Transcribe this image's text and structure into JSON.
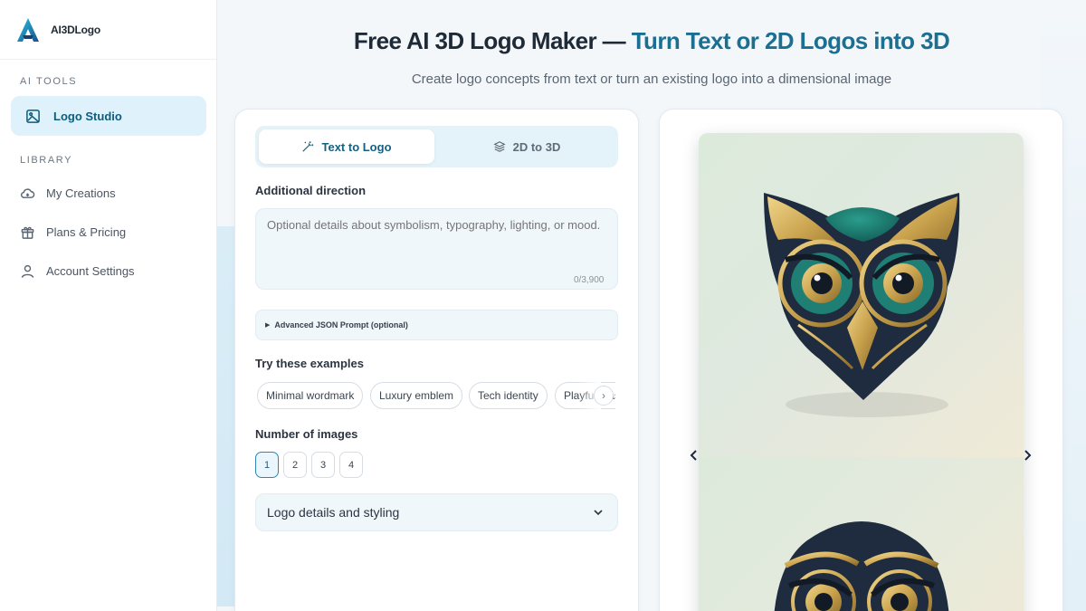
{
  "brand": {
    "name": "AI3DLogo"
  },
  "sidebar": {
    "section_ai": "AI TOOLS",
    "section_library": "LIBRARY",
    "active_item": {
      "label": "Logo Studio",
      "icon": "image-icon"
    },
    "items": [
      {
        "label": "My Creations",
        "icon": "cloud-icon"
      },
      {
        "label": "Plans & Pricing",
        "icon": "gift-icon"
      },
      {
        "label": "Account Settings",
        "icon": "user-icon"
      }
    ]
  },
  "header": {
    "title_part1": "Free AI 3D Logo Maker — ",
    "title_part2": "Turn Text or 2D Logos into 3D",
    "subtitle": "Create logo concepts from text or turn an existing logo into a dimensional image"
  },
  "form": {
    "tabs": [
      {
        "label": "Text to Logo",
        "icon": "magic-wand-icon",
        "active": true
      },
      {
        "label": "2D to 3D",
        "icon": "layers-icon",
        "active": false
      }
    ],
    "direction_label": "Additional direction",
    "direction_placeholder": "Optional details about symbolism, typography, lighting, or mood.",
    "direction_counter": "0/3,900",
    "advanced_label": "Advanced JSON Prompt (optional)",
    "examples_label": "Try these examples",
    "examples": [
      "Minimal wordmark",
      "Luxury emblem",
      "Tech identity",
      "Playful mascot"
    ],
    "count_label": "Number of images",
    "counts": [
      "1",
      "2",
      "3",
      "4"
    ],
    "selected_count": "1",
    "details_label": "Logo details and styling"
  },
  "preview": {
    "images": [
      "owl-emblem-teal-gold",
      "owl-emblem-navy-gold"
    ]
  },
  "colors": {
    "accent": "#1b6f92",
    "active_bg": "#dff1fb",
    "owl_dark": "#1f2b3e",
    "owl_teal": "#1f7f74",
    "owl_gold": "#c9a24d"
  }
}
